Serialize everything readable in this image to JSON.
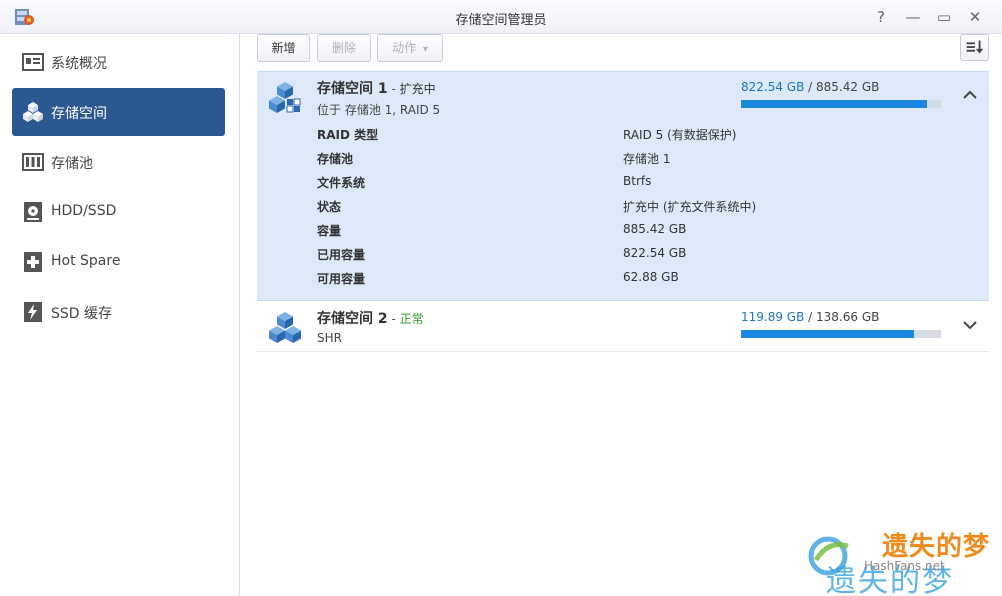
{
  "window": {
    "title": "存储空间管理员",
    "help_glyph": "?",
    "minimize_glyph": "—",
    "maximize_glyph": "▭",
    "close_glyph": "✕"
  },
  "sidebar": {
    "items": [
      {
        "label": "系统概况",
        "icon": "overview-icon",
        "active": false
      },
      {
        "label": "存储空间",
        "icon": "volume-cubes-icon",
        "active": true
      },
      {
        "label": "存储池",
        "icon": "storage-pool-icon",
        "active": false
      },
      {
        "label": "HDD/SSD",
        "icon": "disk-icon",
        "active": false
      },
      {
        "label": "Hot Spare",
        "icon": "plus-box-icon",
        "active": false
      },
      {
        "label": "SSD 缓存",
        "icon": "flash-cache-icon",
        "active": false
      }
    ]
  },
  "toolbar": {
    "create_label": "新增",
    "delete_label": "删除",
    "action_label": "动作",
    "action_caret": "▾"
  },
  "volumes": [
    {
      "name": "存储空间 1",
      "separator": " - ",
      "status": "扩充中",
      "status_color": "#333333",
      "subtitle": "位于 存储池 1, RAID 5",
      "used": "822.54 GB",
      "slash": " / ",
      "total": "885.42 GB",
      "usage_fraction": 0.929,
      "expanded": true,
      "details": [
        {
          "key": "RAID 类型",
          "value": "RAID 5 (有数据保护)"
        },
        {
          "key": "存储池",
          "value": "存储池 1"
        },
        {
          "key": "文件系统",
          "value": "Btrfs"
        },
        {
          "key": "状态",
          "value": "扩充中 (扩充文件系统中)"
        },
        {
          "key": "容量",
          "value": "885.42 GB"
        },
        {
          "key": "已用容量",
          "value": "822.54 GB"
        },
        {
          "key": "可用容量",
          "value": "62.88 GB"
        }
      ]
    },
    {
      "name": "存储空间 2",
      "separator": " - ",
      "status": "正常",
      "status_color": "#2e9a2e",
      "subtitle": "SHR",
      "used": "119.89 GB",
      "slash": " / ",
      "total": "138.66 GB",
      "usage_fraction": 0.865,
      "expanded": false
    }
  ],
  "watermark": {
    "top_text": "遗失的梦",
    "site_text": "HashFans.net",
    "bottom_text": "遗失的梦"
  },
  "colors": {
    "accent": "#2c5891",
    "selected_row": "#dde9f8",
    "usage_bar": "#1a87e2",
    "used_text": "#1a74c4"
  }
}
